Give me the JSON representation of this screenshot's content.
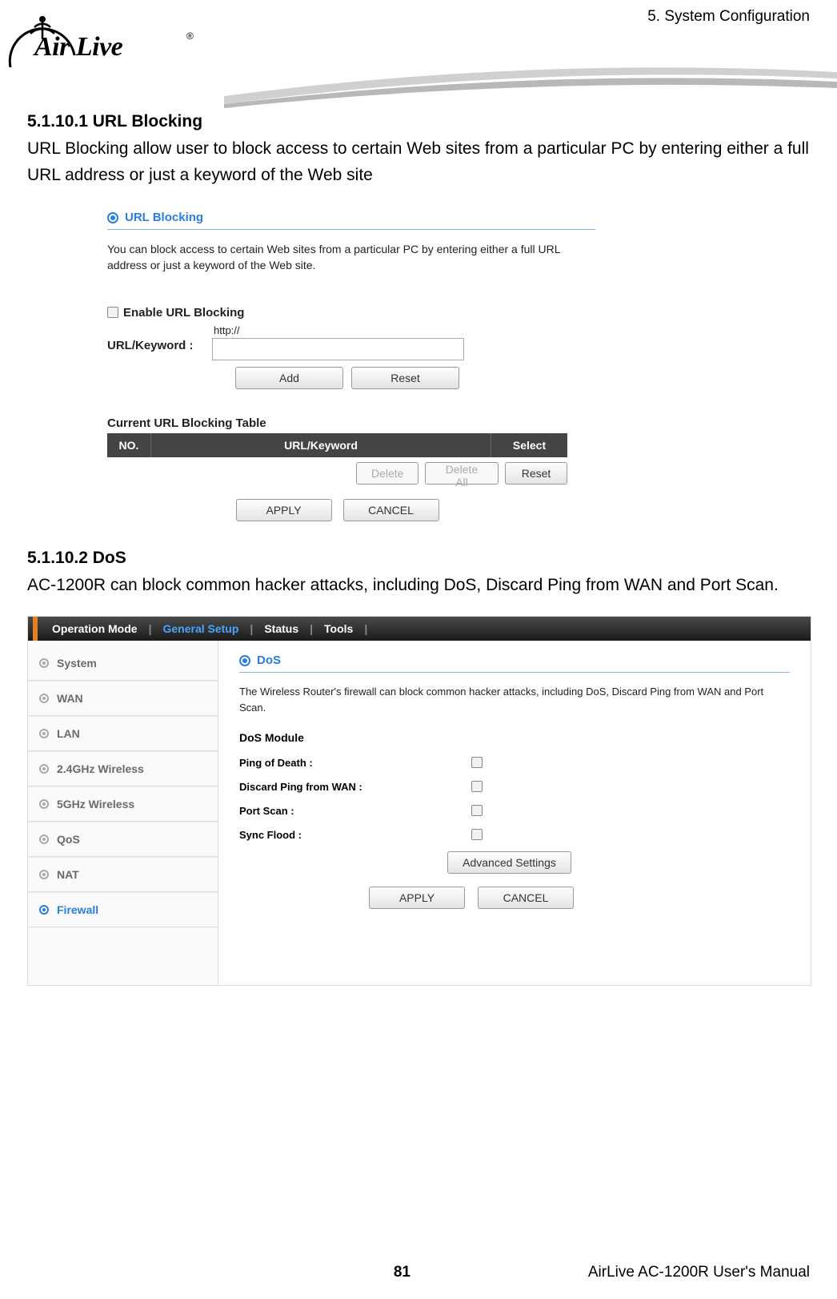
{
  "header": {
    "chapter": "5.  System  Configuration",
    "logo_text": "Air Live",
    "logo_r": "®"
  },
  "s1": {
    "num": "5.1.10.1",
    "title": "URL Blocking",
    "body": "URL Blocking allow user to block access to certain Web sites from a particular PC by entering either a full URL address or just a keyword of the Web site"
  },
  "url_panel": {
    "title": "URL Blocking",
    "desc": "You can block access to certain Web sites from a particular PC by entering either a full URL address or just a keyword of the Web site.",
    "enable_label": "Enable URL Blocking",
    "url_label": "URL/Keyword :",
    "http_prefix": "http://",
    "add": "Add",
    "reset": "Reset",
    "table_title": "Current URL Blocking Table",
    "th_no": "NO.",
    "th_url": "URL/Keyword",
    "th_sel": "Select",
    "delete": "Delete",
    "delete_all": "Delete All",
    "reset2": "Reset",
    "apply": "APPLY",
    "cancel": "CANCEL"
  },
  "s2": {
    "num": "5.1.10.2",
    "title": "DoS",
    "body": "AC-1200R can block common hacker attacks, including DoS, Discard Ping from WAN and Port Scan."
  },
  "dos_panel": {
    "tabs": {
      "op": "Operation Mode",
      "gs": "General Setup",
      "st": "Status",
      "tl": "Tools"
    },
    "side": {
      "system": "System",
      "wan": "WAN",
      "lan": "LAN",
      "w24": "2.4GHz Wireless",
      "w5": "5GHz Wireless",
      "qos": "QoS",
      "nat": "NAT",
      "fw": "Firewall"
    },
    "title": "DoS",
    "desc": "The Wireless Router's firewall can block common hacker attacks, including DoS, Discard Ping from WAN and Port Scan.",
    "mod_title": "DoS Module",
    "rows": {
      "pod": "Ping of Death :",
      "dpw": "Discard Ping from WAN :",
      "ps": "Port Scan :",
      "sf": "Sync Flood :"
    },
    "adv": "Advanced Settings",
    "apply": "APPLY",
    "cancel": "CANCEL"
  },
  "footer": {
    "page": "81",
    "manual": "AirLive AC-1200R User's Manual"
  }
}
